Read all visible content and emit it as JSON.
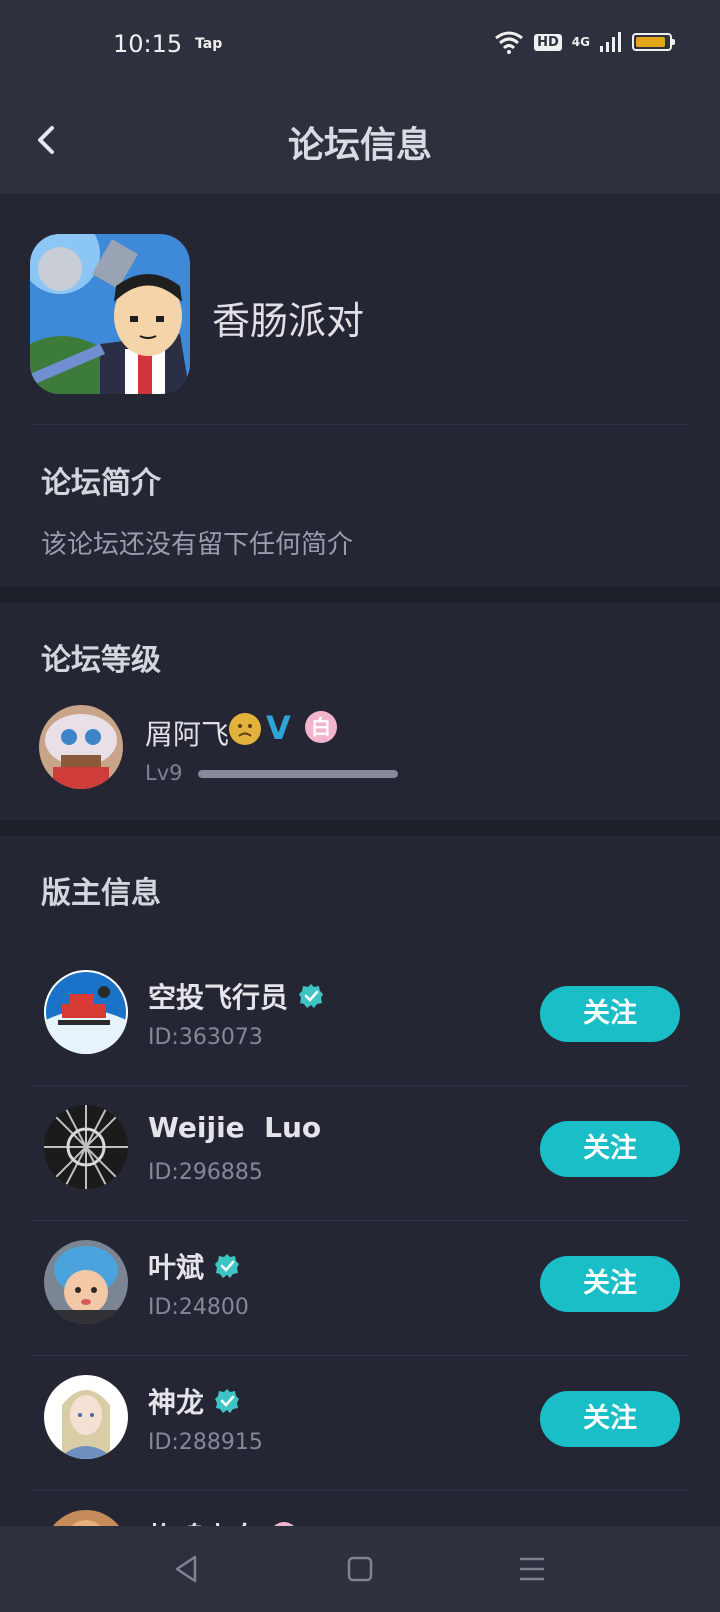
{
  "status_bar": {
    "time": "10:15",
    "carrier_label": "Tap",
    "hd_label": "HD",
    "network_label": "4G",
    "battery_level": 0.9,
    "battery_color": "#e3a619"
  },
  "header": {
    "title": "论坛信息",
    "back_icon": "chevron-left-icon"
  },
  "forum": {
    "name": "香肠派对",
    "intro_title": "论坛简介",
    "intro_text": "该论坛还没有留下任何简介"
  },
  "level": {
    "section_title": "论坛等级",
    "user_name": "屑阿飞",
    "v_badge": "V",
    "pink_badge": "白",
    "level_label": "Lv9",
    "progress": 1.0
  },
  "moderators": {
    "section_title": "版主信息",
    "follow_label": "关注",
    "items": [
      {
        "name": "空投飞行员",
        "id": "ID:363073",
        "verified": true
      },
      {
        "name": "Weijie  Luo",
        "id": "ID:296885",
        "verified": false
      },
      {
        "name": "叶斌",
        "id": "ID:24800",
        "verified": true
      },
      {
        "name": "神龙",
        "id": "ID:288915",
        "verified": true
      },
      {
        "name": "炸鸡少女",
        "id": "",
        "verified": false
      }
    ]
  },
  "colors": {
    "accent": "#19bec7",
    "background": "#242633",
    "header": "#2d303d"
  }
}
